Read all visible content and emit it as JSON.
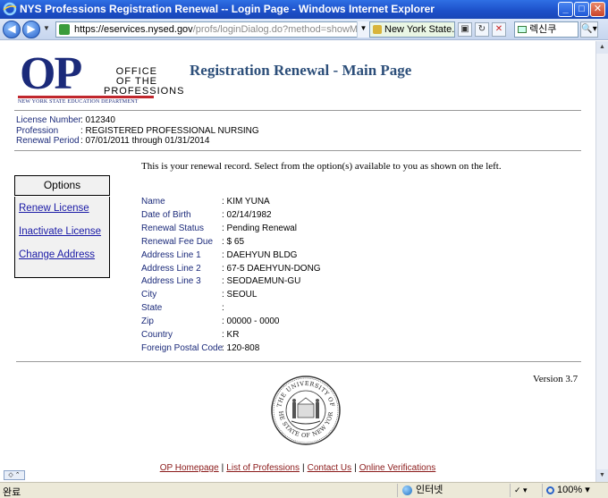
{
  "window": {
    "title": "NYS Professions Registration Renewal -- Login Page - Windows Internet Explorer",
    "minimize": "_",
    "maximize": "□",
    "close": "✕"
  },
  "addressbar": {
    "url_domain": "https://eservices.nysed.gov",
    "url_path": "/profs/loginDialog.do?method=showMenu",
    "cert_label": "New York State...",
    "search_text": "렉신쿠",
    "back": "◀",
    "forward": "▶",
    "dropdown": "▼",
    "search_go": "🔍▾"
  },
  "logo": {
    "letters": "OP",
    "office_line1": "OFFICE",
    "office_line2": "OF THE",
    "office_line3": "PROFESSIONS",
    "dept": "NEW YORK STATE EDUCATION DEPARTMENT"
  },
  "page": {
    "title": "Registration Renewal - Main Page"
  },
  "license": {
    "number_label": "License Number",
    "number": ": 012340",
    "profession_label": "Profession",
    "profession": ": REGISTERED PROFESSIONAL NURSING",
    "period_label": "Renewal Period",
    "period": ": 07/01/2011 through 01/31/2014"
  },
  "intro": "This is your renewal record. Select from the option(s) available to you as shown on the left.",
  "options": {
    "heading": "Options",
    "items": [
      "Renew License",
      "Inactivate License",
      "Change Address"
    ]
  },
  "record": [
    {
      "label": "Name",
      "value": ": KIM YUNA"
    },
    {
      "label": "Date of Birth",
      "value": ": 02/14/1982"
    },
    {
      "label": "Renewal Status",
      "value": ": Pending Renewal"
    },
    {
      "label": "Renewal Fee Due",
      "value": ": $ 65"
    },
    {
      "label": "Address Line 1",
      "value": ": DAEHYUN BLDG"
    },
    {
      "label": "Address Line 2",
      "value": ": 67-5  DAEHYUN-DONG"
    },
    {
      "label": "Address Line 3",
      "value": ": SEODAEMUN-GU"
    },
    {
      "label": "City",
      "value": ": SEOUL"
    },
    {
      "label": "State",
      "value": ":"
    },
    {
      "label": "Zip",
      "value": ": 00000 - 0000"
    },
    {
      "label": "Country",
      "value": ": KR"
    },
    {
      "label": "Foreign Postal Code",
      "value": ": 120-808"
    }
  ],
  "version": "Version 3.7",
  "seal": {
    "top_text": "THE UNIVERSITY OF",
    "bottom_text": "THE STATE OF NEW YORK"
  },
  "footer": {
    "links": [
      "OP Homepage",
      "List of Professions",
      "Contact Us",
      "Online Verifications"
    ],
    "separator": "|"
  },
  "statusbar": {
    "status": "완료",
    "zone": "인터넷",
    "zoom": "100%",
    "zoom_drop": "▾"
  },
  "colors": {
    "label_blue": "#1b2a7a",
    "title_blue": "#2d4f7a",
    "link_blue": "#1a1aa6",
    "footer_link": "#8b1a1a",
    "logo_red": "#c0272d"
  }
}
